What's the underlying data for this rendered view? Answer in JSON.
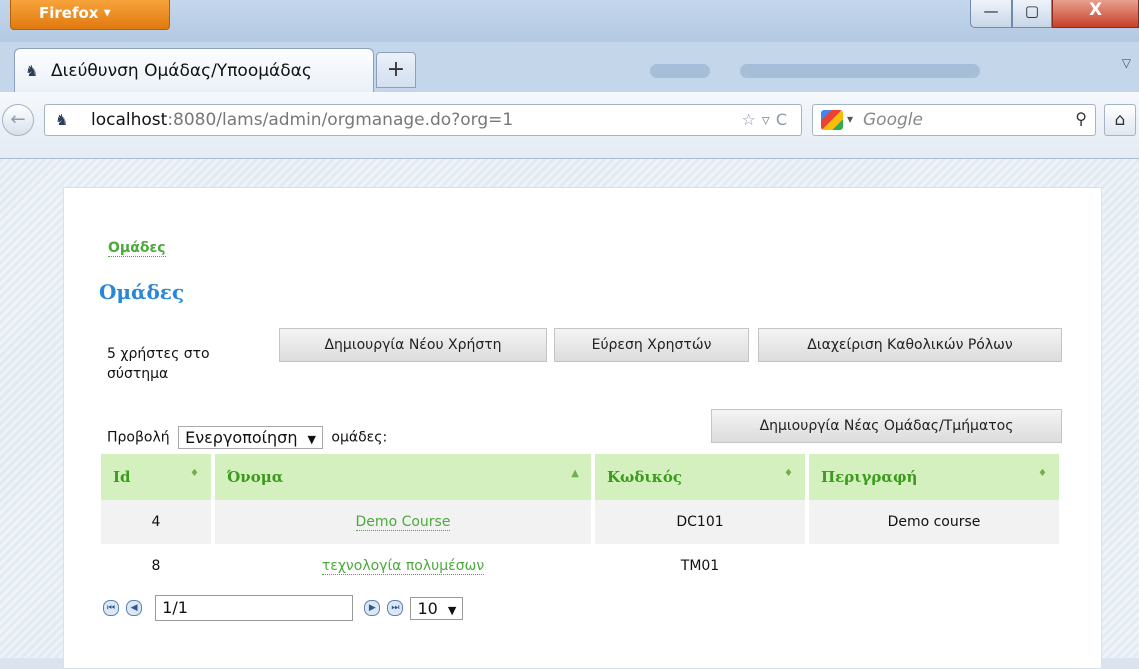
{
  "browser": {
    "menu_label": "Firefox",
    "menu_arrow": "▼",
    "window_controls": [
      "—",
      "▢",
      "X"
    ],
    "tab_title": "Διεύθυνση Ομάδας/Υποομάδας",
    "new_tab": "+",
    "url_host": "localhost",
    "url_rest": ":8080/lams/admin/orgmanage.do?org=1",
    "url_icons": "☆▿C",
    "search_engine": "Google",
    "search_icon": "⚲",
    "home_icon": "⌂",
    "back_icon": "←",
    "tabs_list_icon": "▽"
  },
  "page": {
    "breadcrumb": "Ομάδες",
    "title": "Ομάδες",
    "user_count": "5 χρήστες στο σύστημα",
    "buttons": {
      "new_user": "Δημιουργία Νέου Χρήστη",
      "find_users": "Εύρεση Χρηστών",
      "global_roles": "Διαχείριση Καθολικών Ρόλων",
      "new_group": "Δημιουργία Νέας Ομάδας/Τμήματος"
    },
    "filter": {
      "prefix": "Προβολή",
      "selected": "Ενεργοποίηση",
      "suffix": "ομάδες:"
    },
    "table": {
      "headers": [
        "Id",
        "Όνομα",
        "Κωδικός",
        "Περιγραφή"
      ],
      "sort_icons": [
        "♦",
        "▲",
        "♦",
        "♦"
      ],
      "rows": [
        {
          "id": "4",
          "name": "Demo Course",
          "code": "DC101",
          "description": "Demo course"
        },
        {
          "id": "8",
          "name": "τεχνολογία πολυμέσων",
          "code": "TM01",
          "description": ""
        }
      ]
    },
    "pager": {
      "page": "1/1",
      "page_size": "10"
    }
  }
}
